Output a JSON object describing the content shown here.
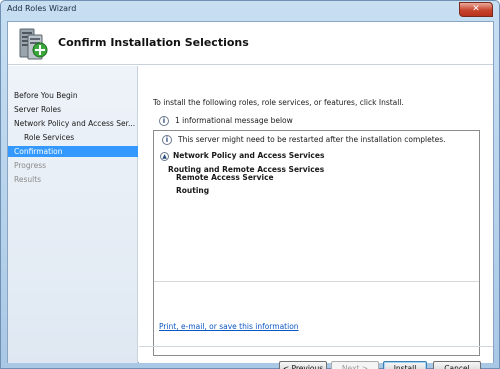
{
  "window": {
    "title": "Add Roles Wizard",
    "close_glyph": "✕"
  },
  "header": {
    "title": "Confirm Installation Selections",
    "icon": "server-roles-icon"
  },
  "nav": {
    "items": [
      {
        "label": "Before You Begin"
      },
      {
        "label": "Server Roles"
      },
      {
        "label": "Network Policy and Access Ser..."
      },
      {
        "label": "Role Services"
      },
      {
        "label": "Confirmation"
      },
      {
        "label": "Progress"
      },
      {
        "label": "Results"
      }
    ]
  },
  "main": {
    "intro": "To install the following roles, role services, or features, click Install.",
    "info_message": "1 informational message below",
    "results": {
      "warning": "This server might need to be restarted after the installation completes.",
      "section_title": "Network Policy and Access Services",
      "service": "Routing and Remote Access Services",
      "sub_services": [
        "Remote Access Service",
        "Routing"
      ]
    },
    "print_link": "Print, e-mail, or save this information"
  },
  "buttons": {
    "previous": "< Previous",
    "next": "Next >",
    "install": "Install",
    "cancel": "Cancel"
  }
}
